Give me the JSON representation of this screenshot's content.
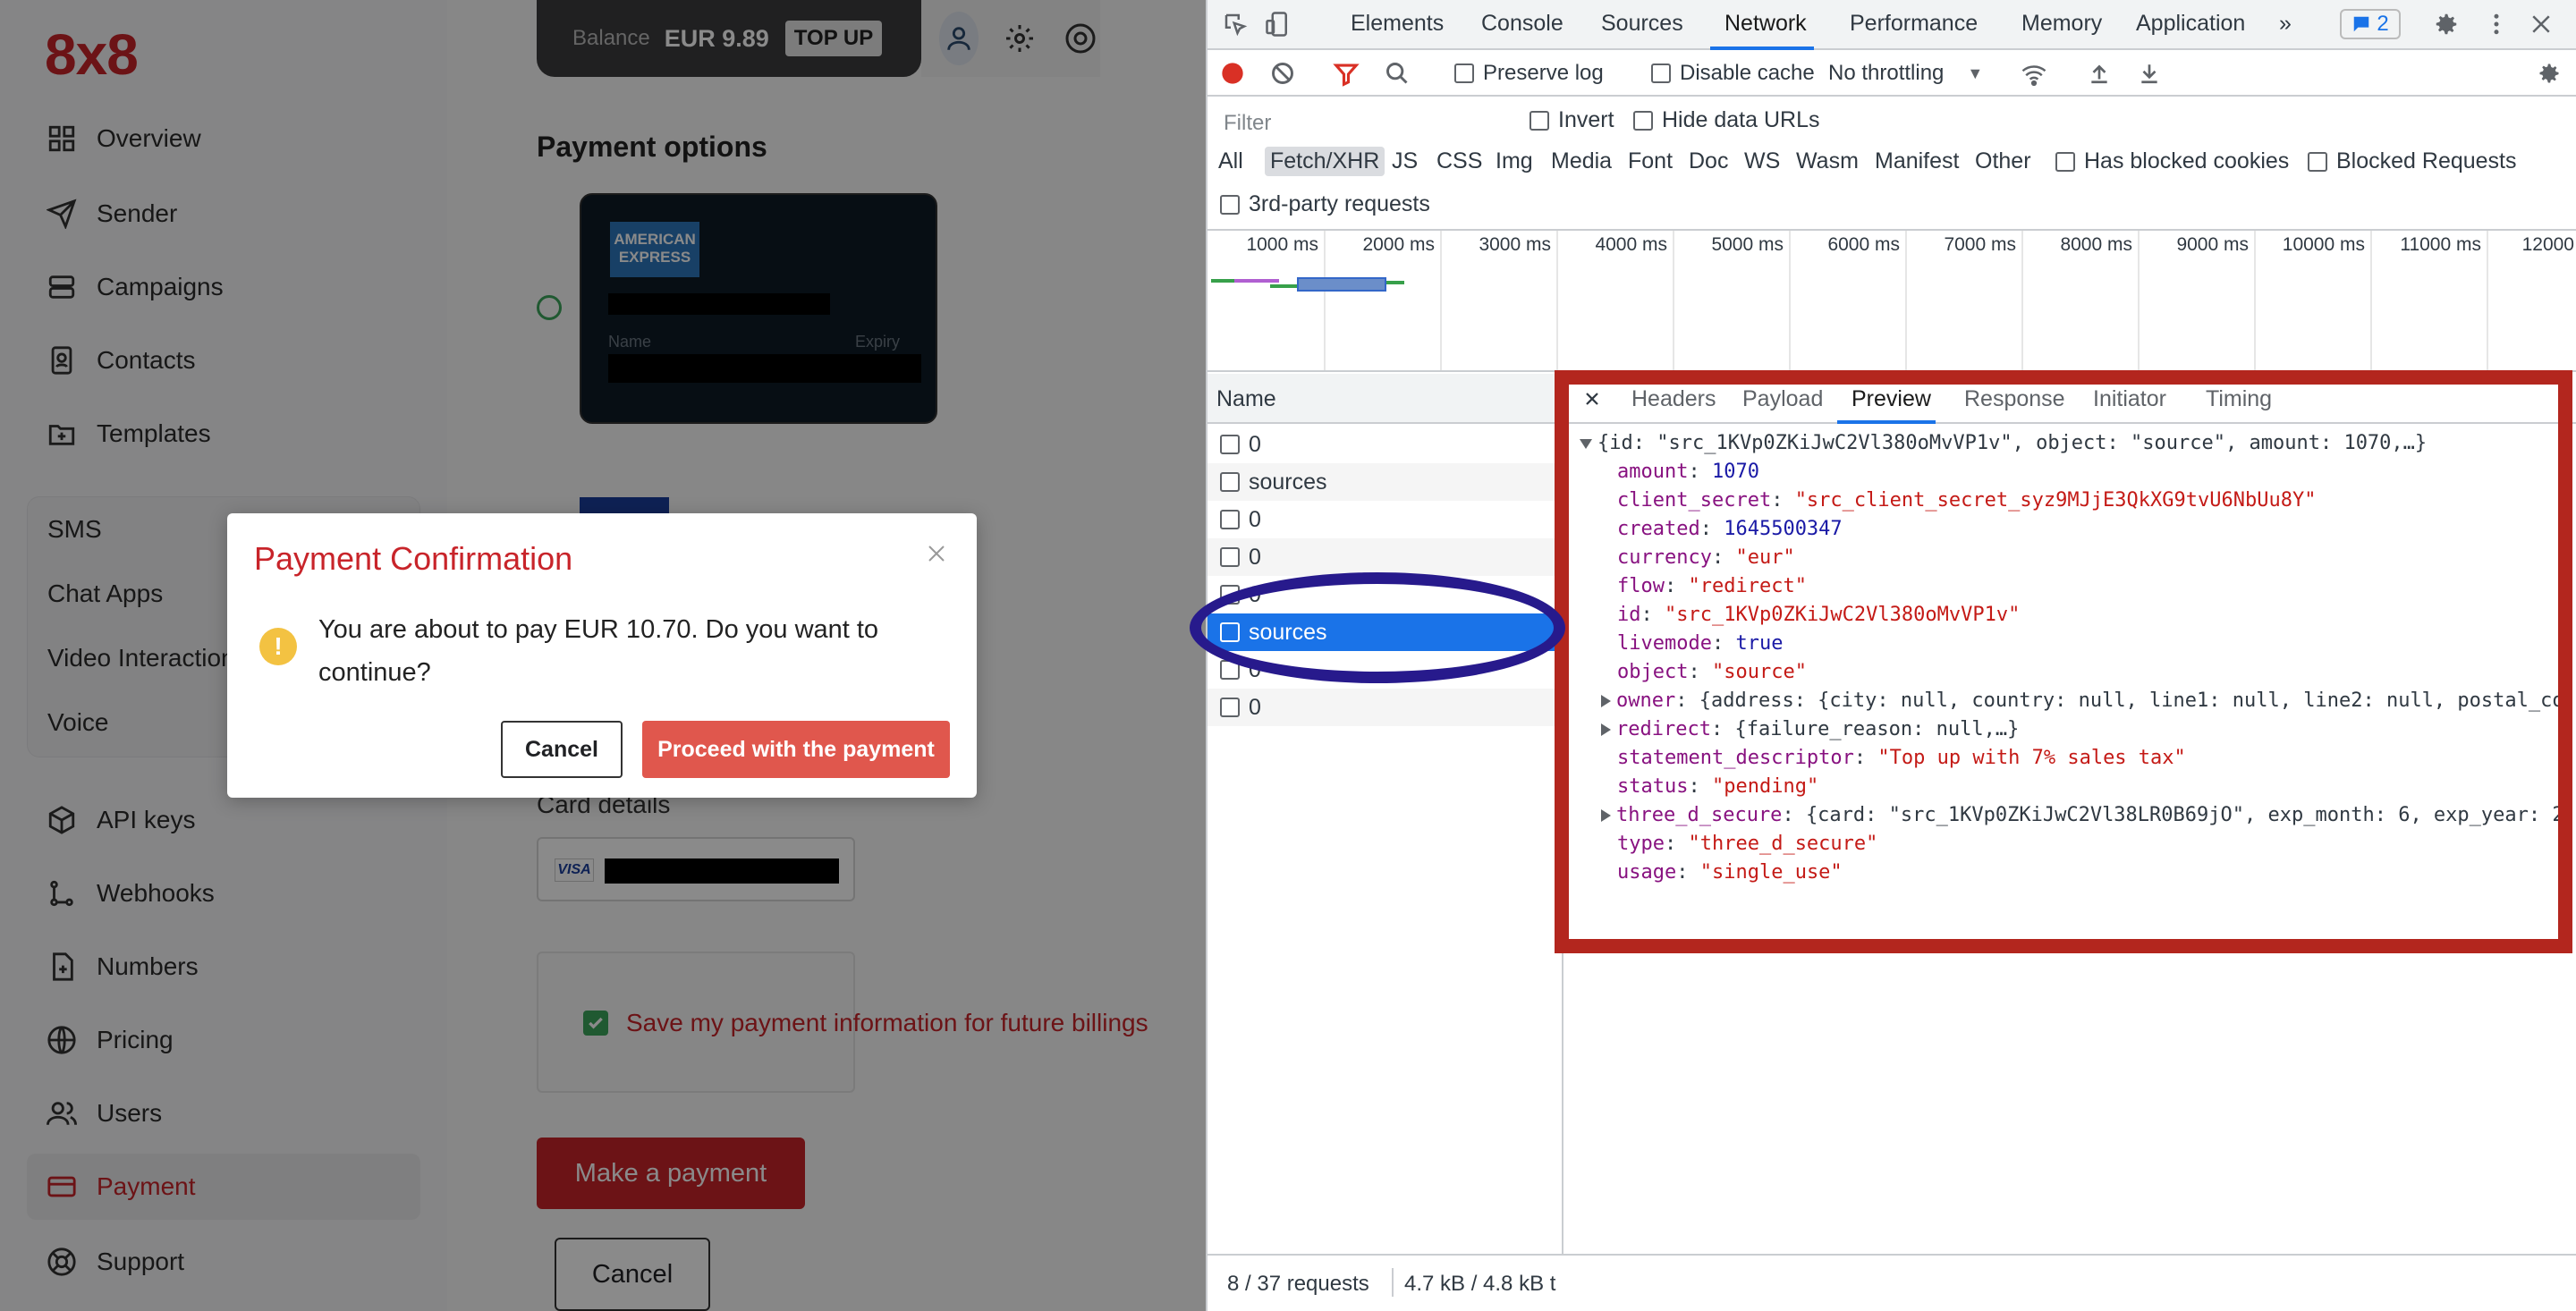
{
  "app": {
    "logo": "8x8",
    "nav": [
      {
        "label": "Overview",
        "icon": "grid-icon"
      },
      {
        "label": "Sender",
        "icon": "send-icon"
      },
      {
        "label": "Campaigns",
        "icon": "campaigns-icon"
      },
      {
        "label": "Contacts",
        "icon": "contacts-icon"
      },
      {
        "label": "Templates",
        "icon": "templates-icon"
      }
    ],
    "channels": [
      "SMS",
      "Chat Apps",
      "Video Interactions",
      "Voice"
    ],
    "nav2": [
      {
        "label": "API keys",
        "icon": "cube-icon"
      },
      {
        "label": "Webhooks",
        "icon": "webhook-icon"
      },
      {
        "label": "Numbers",
        "icon": "numbers-icon"
      },
      {
        "label": "Pricing",
        "icon": "globe-icon"
      },
      {
        "label": "Users",
        "icon": "users-icon"
      },
      {
        "label": "Payment",
        "icon": "card-icon",
        "active": true
      },
      {
        "label": "Support",
        "icon": "lifebuoy-icon"
      }
    ],
    "balance_label": "Balance",
    "balance_value": "EUR 9.89",
    "top_up": "TOP UP",
    "payment_options_title": "Payment options",
    "amex_logo": "AMERICAN EXPRESS",
    "card_name_label": "Name",
    "card_expiry_label": "Expiry",
    "card_details_label": "Card details",
    "visa_mark": "VISA",
    "save_info": "Save my payment information for future billings",
    "make_payment": "Make a payment",
    "cancel": "Cancel",
    "accent": "#c8242a"
  },
  "modal": {
    "title": "Payment Confirmation",
    "message": "You are about to pay EUR 10.70. Do you want to continue?",
    "cancel": "Cancel",
    "proceed": "Proceed with the payment",
    "close_icon": "close-icon"
  },
  "devtools": {
    "tabs": [
      "Elements",
      "Console",
      "Sources",
      "Network",
      "Performance",
      "Memory",
      "Application"
    ],
    "active_tab": "Network",
    "more": "»",
    "issues_count": "2",
    "toolbar": {
      "preserve_log": "Preserve log",
      "disable_cache": "Disable cache",
      "throttling": "No throttling"
    },
    "filter": {
      "placeholder": "Filter",
      "invert": "Invert",
      "hide_data_urls": "Hide data URLs",
      "types": [
        "All",
        "Fetch/XHR",
        "JS",
        "CSS",
        "Img",
        "Media",
        "Font",
        "Doc",
        "WS",
        "Wasm",
        "Manifest",
        "Other"
      ],
      "active_type": "Fetch/XHR",
      "has_blocked_cookies": "Has blocked cookies",
      "blocked_requests": "Blocked Requests",
      "third_party": "3rd-party requests"
    },
    "timeline_ticks": [
      "1000 ms",
      "2000 ms",
      "3000 ms",
      "4000 ms",
      "5000 ms",
      "6000 ms",
      "7000 ms",
      "8000 ms",
      "9000 ms",
      "10000 ms",
      "11000 ms",
      "12000"
    ],
    "name_header": "Name",
    "requests": [
      "0",
      "sources",
      "0",
      "0",
      "0",
      "sources",
      "0",
      "0"
    ],
    "selected_request": 5,
    "detail_tabs": [
      "Headers",
      "Payload",
      "Preview",
      "Response",
      "Initiator",
      "Timing"
    ],
    "active_detail_tab": "Preview",
    "preview": {
      "summary": "{id: \"src_1KVp0ZKiJwC2Vl380oMvVP1v\", object: \"source\", amount: 1070,…}",
      "amount": "1070",
      "client_secret": "\"src_client_secret_syz9MJjE3QkXG9tvU6NbUu8Y\"",
      "created": "1645500347",
      "currency": "\"eur\"",
      "flow": "\"redirect\"",
      "id": "\"src_1KVp0ZKiJwC2Vl380oMvVP1v\"",
      "livemode": "true",
      "object": "\"source\"",
      "owner": "{address: {city: null, country: null, line1: null, line2: null, postal_co",
      "redirect": "{failure_reason: null,…}",
      "statement_descriptor": "\"Top up with 7% sales tax\"",
      "status": "\"pending\"",
      "three_d_secure": "{card: \"src_1KVp0ZKiJwC2Vl38LR0B69jO\", exp_month: 6, exp_year: 2",
      "type": "\"three_d_secure\"",
      "usage": "\"single_use\""
    },
    "status_requests": "8 / 37 requests",
    "status_size": "4.7 kB / 4.8 kB t"
  },
  "annotation_colors": {
    "red_box": "#b3261e",
    "blue_ellipse": "#271a8c"
  }
}
